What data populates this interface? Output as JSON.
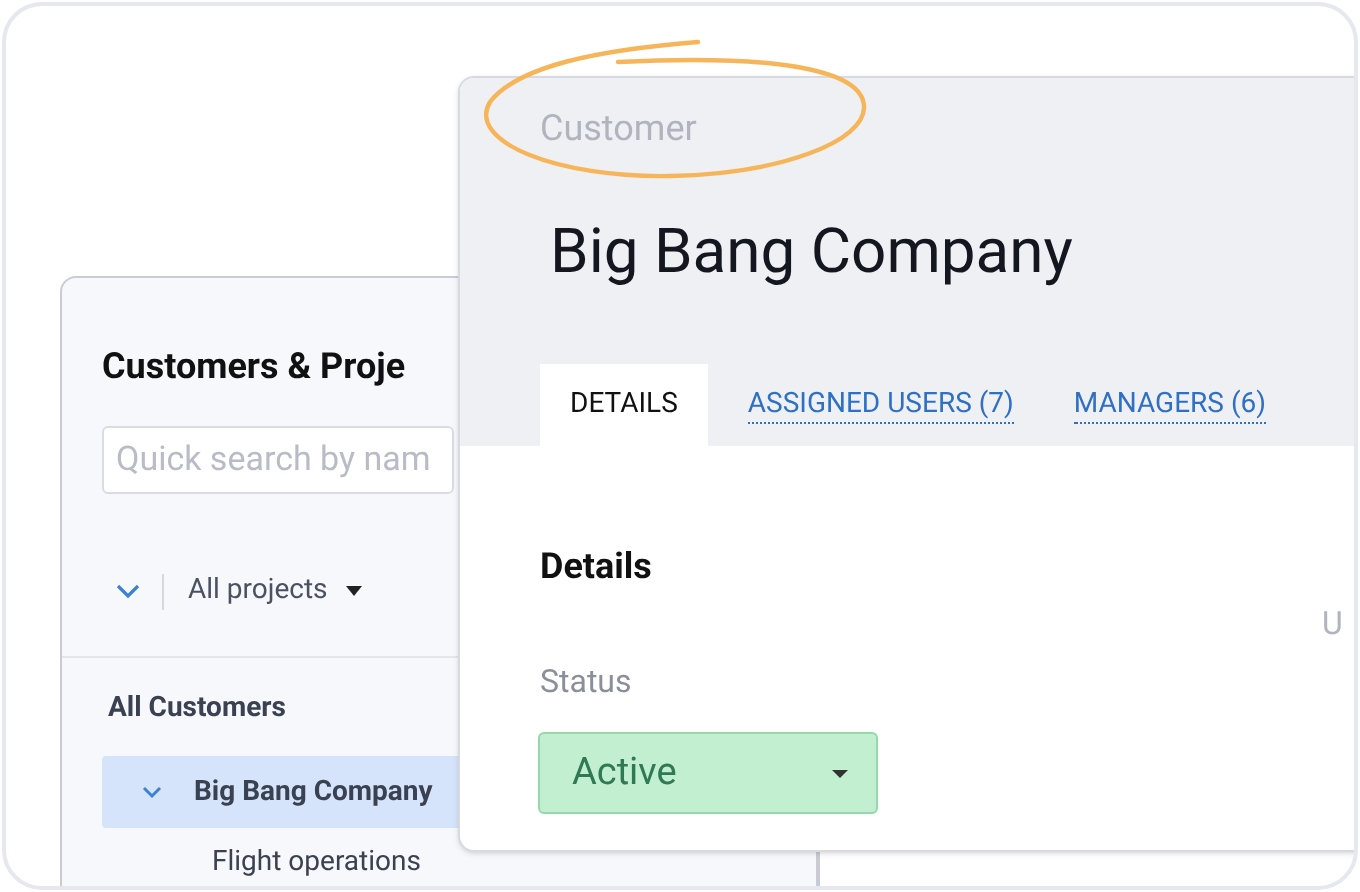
{
  "back_panel": {
    "title": "Customers & Proje",
    "search": {
      "placeholder": "Quick search by nam"
    },
    "filter": "All projects",
    "tree": {
      "label": "All Customers",
      "children": [
        {
          "label": "Big Bang Company",
          "expanded": true,
          "selected": true,
          "children": [
            {
              "label": "Flight operations",
              "selected": false
            }
          ]
        }
      ]
    }
  },
  "customer_card": {
    "kicker": "Customer",
    "title": "Big Bang Company",
    "tabs": [
      {
        "label": "DETAILS",
        "selected": true
      },
      {
        "label": "ASSIGNED USERS (7)",
        "selected": false
      },
      {
        "label": "MANAGERS (6)",
        "selected": false
      }
    ],
    "section": "Details",
    "status_label": "Status",
    "status": {
      "value": "Active"
    },
    "column_2_label": "U"
  }
}
